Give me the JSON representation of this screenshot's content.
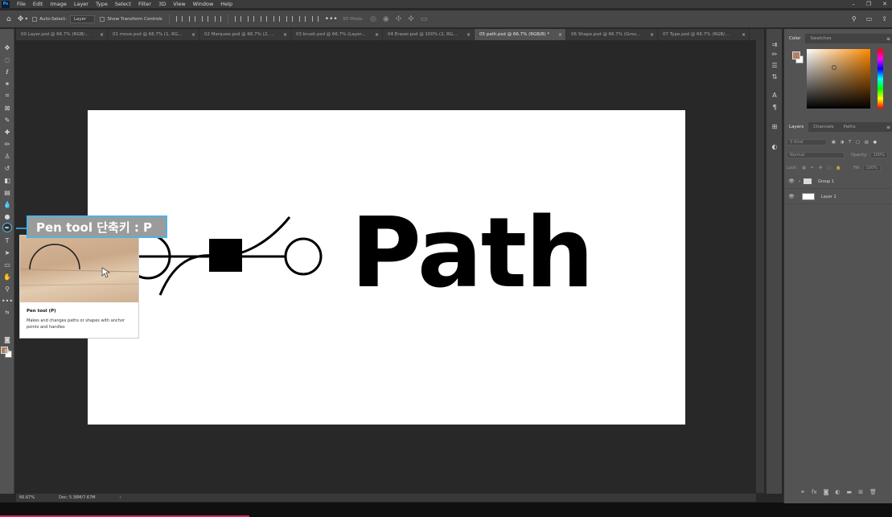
{
  "app": {
    "logo": "Ps"
  },
  "menu": [
    "File",
    "Edit",
    "Image",
    "Layer",
    "Type",
    "Select",
    "Filter",
    "3D",
    "View",
    "Window",
    "Help"
  ],
  "options": {
    "auto_select_label": "Auto-Select:",
    "auto_select_value": "Layer",
    "transform_label": "Show Transform Controls",
    "mode_label": "3D Mode:",
    "more": "•••"
  },
  "tabs": [
    {
      "label": "00 Layer.psd @ 66.7% (RGB/...",
      "active": false
    },
    {
      "label": "01 move.psd @ 66.7% (1, RG...",
      "active": false
    },
    {
      "label": "02 Marquee.psd @ 66.7% (2, ...",
      "active": false
    },
    {
      "label": "03 brush.psd @ 66.7% (Layer...",
      "active": false
    },
    {
      "label": "04 Eraser.psd @ 100% (2, RG...",
      "active": false
    },
    {
      "label": "05 path.psd @ 66.7% (RGB/8) *",
      "active": true
    },
    {
      "label": "06 Shape.psd @ 66.7% (Grou...",
      "active": false
    },
    {
      "label": "07 Type.psd @ 66.7% (RGB/...",
      "active": false
    }
  ],
  "tab_close": "×",
  "canvas": {
    "headline": "Path"
  },
  "callout": {
    "text": "Pen tool 단축키 : P"
  },
  "tooltip": {
    "title": "Pen tool (P)",
    "description": "Makes and changes paths or shapes with anchor points and handles"
  },
  "status": {
    "zoom": "66.67%",
    "doc": "Doc: 5.36M/7.67M",
    "arrow": "›"
  },
  "color_panel": {
    "tabs": [
      "Color",
      "Swatches"
    ],
    "fg": "#b08060",
    "bg": "#ffffff"
  },
  "layers_panel": {
    "tabs": [
      "Layers",
      "Channels",
      "Paths"
    ],
    "filter_label": "Kind",
    "blend_mode": "Normal",
    "opacity_label": "Opacity:",
    "opacity_value": "100%",
    "lock_label": "Lock:",
    "fill_label": "Fill:",
    "fill_value": "100%",
    "layers": [
      {
        "name": "Group 1",
        "type": "group"
      },
      {
        "name": "Layer 1",
        "type": "layer"
      }
    ]
  },
  "colors": {
    "accent": "#4ab4e6",
    "highlight_bar": "#e0245e"
  }
}
